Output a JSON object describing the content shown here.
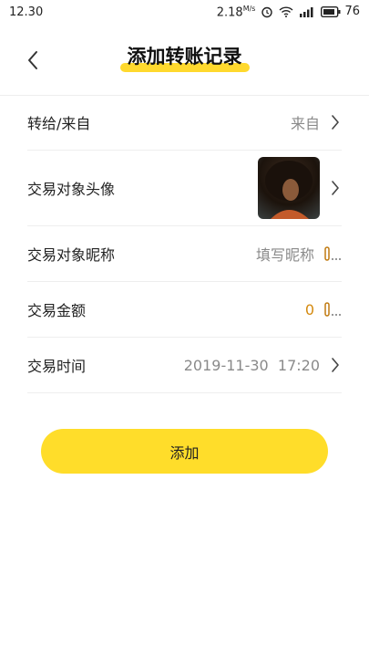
{
  "status_bar": {
    "time": "12.30",
    "network_speed": "2.18",
    "network_unit": "M/s",
    "battery": "76"
  },
  "header": {
    "title": "添加转账记录",
    "back_icon": "chevron-left-icon",
    "accent_color": "#ffd92e"
  },
  "form": {
    "rows": [
      {
        "label": "转给/来自",
        "value": "来自",
        "icon": "chevron-right-icon"
      },
      {
        "label": "交易对象头像",
        "value": "",
        "icon": "chevron-right-icon"
      },
      {
        "label": "交易对象昵称",
        "placeholder": "填写昵称",
        "icon": "edit-icon"
      },
      {
        "label": "交易金额",
        "value": "0",
        "icon": "edit-icon"
      },
      {
        "label": "交易时间",
        "value": "2019-11-30  17:20",
        "icon": "chevron-right-icon"
      }
    ]
  },
  "add_button": {
    "label": "添加",
    "color": "#ffdd2a"
  }
}
